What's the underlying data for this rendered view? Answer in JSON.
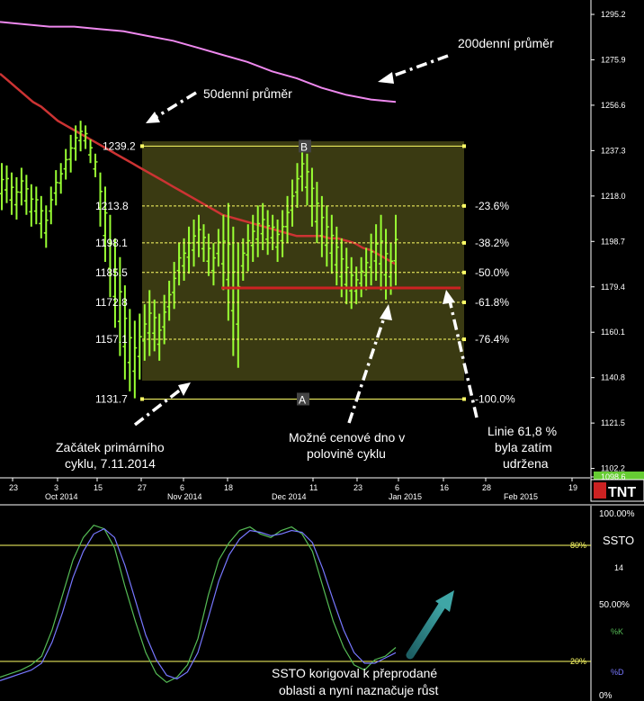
{
  "chart_data": [
    {
      "type": "ohlc",
      "y_axis": {
        "scale": [
          1098.6,
          1300
        ],
        "ticks": [
          "1295.2",
          "1275.9",
          "1256.6",
          "1237.3",
          "1218.0",
          "1198.7",
          "1179.4",
          "1160.1",
          "1140.8",
          "1121.5",
          "1102.2",
          "1098.6"
        ]
      },
      "x_axis": {
        "day_ticks": [
          "23",
          "3",
          "15",
          "27",
          "6",
          "18",
          "11",
          "23",
          "6",
          "16",
          "28",
          "19"
        ],
        "month_labels": [
          "Oct 2014",
          "Nov 2014",
          "Dec 2014",
          "Jan 2015",
          "Feb 2015"
        ]
      },
      "fib_retracement": {
        "levels": [
          {
            "price": 1213.8,
            "price_label": "1213.8",
            "pct": "-23.6%"
          },
          {
            "price": 1198.1,
            "price_label": "1198.1",
            "pct": "-38.2%"
          },
          {
            "price": 1185.5,
            "price_label": "1185.5",
            "pct": "-50.0%"
          },
          {
            "price": 1172.8,
            "price_label": "1172.8",
            "pct": "-61.8%"
          },
          {
            "price": 1157.1,
            "price_label": "1157.1",
            "pct": "-76.4%"
          },
          {
            "price": 1131.7,
            "price_label": "1131.7",
            "pct": "-100.0%"
          }
        ],
        "top_price": 1239.2,
        "top_label": "1239.2",
        "point_b": "B",
        "point_a": "A"
      },
      "series": [
        {
          "name": "price",
          "color": "#99ff33",
          "bars": [
            [
              1232,
              1212
            ],
            [
              1231,
              1215
            ],
            [
              1228,
              1210
            ],
            [
              1226,
              1208
            ],
            [
              1230,
              1214
            ],
            [
              1227,
              1210
            ],
            [
              1223,
              1205
            ],
            [
              1222,
              1206
            ],
            [
              1218,
              1200
            ],
            [
              1214,
              1196
            ],
            [
              1222,
              1206
            ],
            [
              1229,
              1214
            ],
            [
              1232,
              1219
            ],
            [
              1238,
              1225
            ],
            [
              1244,
              1228
            ],
            [
              1248,
              1233
            ],
            [
              1250,
              1237
            ],
            [
              1248,
              1238
            ],
            [
              1242,
              1232
            ],
            [
              1236,
              1226
            ],
            [
              1228,
              1205
            ],
            [
              1222,
              1190
            ],
            [
              1210,
              1175
            ],
            [
              1200,
              1162
            ],
            [
              1192,
              1150
            ],
            [
              1180,
              1140
            ],
            [
              1170,
              1135
            ],
            [
              1165,
              1132
            ],
            [
              1168,
              1140
            ],
            [
              1172,
              1148
            ],
            [
              1178,
              1150
            ],
            [
              1174,
              1152
            ],
            [
              1168,
              1148
            ],
            [
              1176,
              1155
            ],
            [
              1182,
              1165
            ],
            [
              1190,
              1170
            ],
            [
              1198,
              1180
            ],
            [
              1200,
              1182
            ],
            [
              1205,
              1185
            ],
            [
              1208,
              1188
            ],
            [
              1210,
              1192
            ],
            [
              1206,
              1190
            ],
            [
              1202,
              1184
            ],
            [
              1198,
              1180
            ],
            [
              1204,
              1188
            ],
            [
              1210,
              1178
            ],
            [
              1215,
              1165
            ],
            [
              1205,
              1150
            ],
            [
              1198,
              1145
            ],
            [
              1200,
              1182
            ],
            [
              1206,
              1186
            ],
            [
              1210,
              1190
            ],
            [
              1214,
              1192
            ],
            [
              1215,
              1195
            ],
            [
              1212,
              1193
            ],
            [
              1210,
              1195
            ],
            [
              1208,
              1190
            ],
            [
              1212,
              1192
            ],
            [
              1218,
              1198
            ],
            [
              1225,
              1205
            ],
            [
              1232,
              1213
            ],
            [
              1238,
              1220
            ],
            [
              1236,
              1214
            ],
            [
              1230,
              1205
            ],
            [
              1224,
              1198
            ],
            [
              1218,
              1192
            ],
            [
              1214,
              1188
            ],
            [
              1210,
              1185
            ],
            [
              1205,
              1180
            ],
            [
              1200,
              1175
            ],
            [
              1196,
              1172
            ],
            [
              1192,
              1170
            ],
            [
              1188,
              1172
            ],
            [
              1192,
              1175
            ],
            [
              1196,
              1178
            ],
            [
              1202,
              1180
            ],
            [
              1206,
              1182
            ],
            [
              1210,
              1178
            ],
            [
              1204,
              1174
            ],
            [
              1198,
              1176
            ],
            [
              1210,
              1180
            ]
          ]
        },
        {
          "name": "50-day MA",
          "color": "#cc3333",
          "values": [
            1270,
            1267,
            1264,
            1261,
            1258,
            1256,
            1253,
            1250,
            1248,
            1246,
            1244,
            1242,
            1240,
            1238,
            1236,
            1234,
            1232,
            1230,
            1228,
            1226,
            1224,
            1222,
            1220,
            1218,
            1216,
            1214,
            1212,
            1210,
            1209,
            1208,
            1207,
            1206,
            1205,
            1204,
            1203,
            1202,
            1201,
            1201,
            1201,
            1201,
            1200,
            1200,
            1199,
            1198,
            1196,
            1195,
            1193,
            1191,
            1189
          ]
        },
        {
          "name": "200-day MA",
          "color": "#ee88ee",
          "values": [
            1292,
            1291,
            1290,
            1290,
            1289,
            1288,
            1286,
            1284,
            1281,
            1278,
            1275,
            1271,
            1268,
            1264,
            1261,
            1259,
            1258
          ]
        }
      ],
      "annotations": {
        "ma200_label": "200denní průměr",
        "ma50_label": "50denní průměr",
        "start_label_line1": "Začátek primárního",
        "start_label_line2": "cyklu, 7.11.2014",
        "bottom_label_line1": "Možné cenové dno v",
        "bottom_label_line2": "polovině cyklu",
        "fib_label_line1": "Linie 61,8 %",
        "fib_label_line2": "byla zatím",
        "fib_label_line3": "udržena"
      },
      "logo": "TNT"
    },
    {
      "type": "line",
      "indicator": "SSTO",
      "y_axis": {
        "ticks": [
          "100.00%",
          "50.00%",
          "0%"
        ],
        "lines": [
          {
            "value": 80,
            "label": "80%"
          },
          {
            "value": 20,
            "label": "20%"
          }
        ]
      },
      "panel_labels": {
        "name": "SSTO",
        "period": "14",
        "k_label": "%K",
        "d_label": "%D"
      },
      "series": [
        {
          "name": "%K",
          "color": "#55bb55",
          "values": [
            8,
            10,
            12,
            15,
            20,
            35,
            55,
            75,
            88,
            95,
            93,
            82,
            60,
            40,
            22,
            10,
            5,
            8,
            15,
            30,
            55,
            75,
            85,
            92,
            94,
            90,
            88,
            92,
            94,
            90,
            80,
            60,
            40,
            25,
            15,
            12,
            18,
            20,
            25
          ]
        },
        {
          "name": "%D",
          "color": "#7777ff",
          "values": [
            6,
            8,
            10,
            12,
            16,
            28,
            45,
            65,
            80,
            90,
            93,
            88,
            72,
            52,
            32,
            18,
            9,
            7,
            11,
            22,
            42,
            63,
            78,
            87,
            92,
            91,
            89,
            90,
            92,
            91,
            85,
            70,
            52,
            35,
            22,
            16,
            16,
            19,
            22
          ]
        }
      ],
      "annotation_line1": "SSTO korigoval k přeprodané",
      "annotation_line2": "oblasti a nyní naznačuje růst"
    }
  ],
  "colors": {
    "background": "#000000",
    "price": "#99ff33",
    "ma50": "#cc3333",
    "ma200": "#ee88ee",
    "fib_fill": "#3a3a12",
    "fib_line": "#ffff66",
    "support_line": "#cc2222",
    "arrow_teal": "#2a8a8a"
  }
}
